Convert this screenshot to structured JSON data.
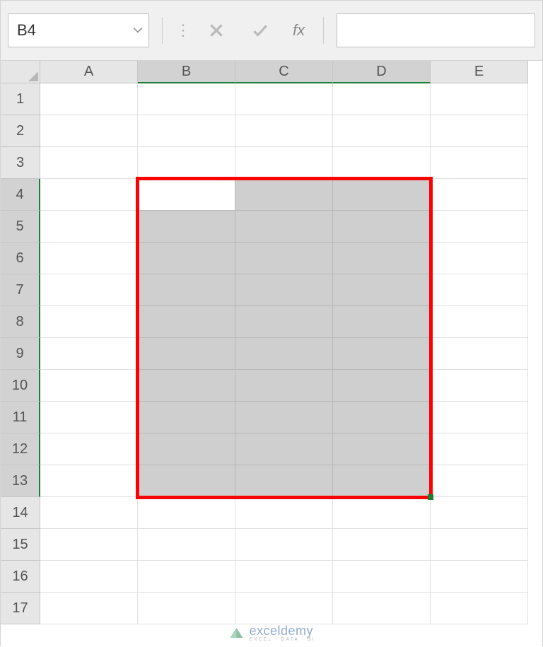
{
  "nameBox": {
    "value": "B4"
  },
  "formulaBar": {
    "value": "",
    "fxLabel": "fx"
  },
  "columns": [
    {
      "label": "A",
      "selected": false
    },
    {
      "label": "B",
      "selected": true
    },
    {
      "label": "C",
      "selected": true
    },
    {
      "label": "D",
      "selected": true
    },
    {
      "label": "E",
      "selected": false
    }
  ],
  "rows": [
    {
      "label": "1",
      "selected": false
    },
    {
      "label": "2",
      "selected": false
    },
    {
      "label": "3",
      "selected": false
    },
    {
      "label": "4",
      "selected": true
    },
    {
      "label": "5",
      "selected": true
    },
    {
      "label": "6",
      "selected": true
    },
    {
      "label": "7",
      "selected": true
    },
    {
      "label": "8",
      "selected": true
    },
    {
      "label": "9",
      "selected": true
    },
    {
      "label": "10",
      "selected": true
    },
    {
      "label": "11",
      "selected": true
    },
    {
      "label": "12",
      "selected": true
    },
    {
      "label": "13",
      "selected": true
    },
    {
      "label": "14",
      "selected": false
    },
    {
      "label": "15",
      "selected": false
    },
    {
      "label": "16",
      "selected": false
    },
    {
      "label": "17",
      "selected": false
    }
  ],
  "selection": {
    "activeCell": "B4",
    "range": "B4:D13",
    "startCol": 1,
    "endCol": 3,
    "startRow": 3,
    "endRow": 12
  },
  "watermark": {
    "main": "exceldemy",
    "sub": "EXCEL · DATA · BI"
  }
}
